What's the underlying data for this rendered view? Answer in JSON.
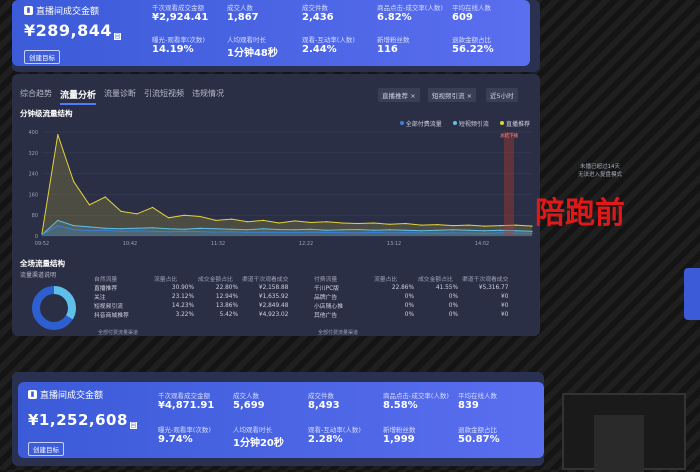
{
  "top_stats": {
    "title": "直播间成交金额",
    "amount": "¥289,844",
    "badge": "回",
    "button": "创建目标",
    "metrics": [
      {
        "label": "千次观看成交金额",
        "value": "¥2,924.41"
      },
      {
        "label": "成交人数",
        "value": "1,867"
      },
      {
        "label": "成交件数",
        "value": "2,436"
      },
      {
        "label": "商品点击-成交率(人数)",
        "value": "6.82%"
      },
      {
        "label": "平均在线人数",
        "value": "609"
      },
      {
        "label": "曝光-观看率(次数)",
        "value": "14.19%"
      },
      {
        "label": "人均观看时长",
        "value": "1分钟48秒"
      },
      {
        "label": "观看-互动率(人数)",
        "value": "2.44%"
      },
      {
        "label": "新增粉丝数",
        "value": "116"
      },
      {
        "label": "退款金额占比",
        "value": "56.22%"
      }
    ]
  },
  "tabs": [
    "综合趋势",
    "流量分析",
    "流量诊断",
    "引流短视频",
    "违规情况"
  ],
  "active_tab": "流量分析",
  "filters": {
    "f1": "直播推荐 ×",
    "f2": "短视频引流 ×",
    "f3": "近5小时"
  },
  "minute_chart_title": "分钟级流量结构",
  "chart_legend": [
    "全部付费流量",
    "短视频引流",
    "直播推荐"
  ],
  "chart_colors": {
    "total": "#e3d23a",
    "short_video": "#5ec0e8",
    "recommend": "#4e79f0",
    "paid": "#3c7fd8"
  },
  "chart_marker": "总结下播",
  "side_note_1": "未播已超过14天",
  "side_note_2": "无法进入复盘模式",
  "annotation": "陪跑前",
  "chart_data": {
    "type": "line",
    "x_ticks": [
      "09:52",
      "10:42",
      "11:32",
      "12:22",
      "13:12",
      "14:02"
    ],
    "y_ticks": [
      0,
      80,
      160,
      240,
      320,
      400
    ],
    "ylim": [
      0,
      400
    ],
    "series": [
      {
        "name": "直播推荐",
        "values": [
          10,
          390,
          210,
          120,
          150,
          95,
          85,
          110,
          70,
          80,
          75,
          60,
          65,
          55,
          60,
          50,
          58,
          52,
          55,
          50,
          48,
          50,
          45,
          48,
          42,
          44,
          40,
          42,
          38,
          40,
          42,
          38
        ]
      },
      {
        "name": "短视频引流",
        "values": [
          5,
          60,
          40,
          35,
          30,
          28,
          30,
          32,
          28,
          26,
          30,
          28,
          26,
          24,
          28,
          25,
          24,
          26,
          22,
          24,
          25,
          22,
          24,
          22,
          20,
          22,
          24,
          22,
          20,
          22,
          20,
          18
        ]
      },
      {
        "name": "全部付费流量",
        "values": [
          5,
          40,
          25,
          20,
          22,
          18,
          20,
          18,
          16,
          18,
          17,
          15,
          16,
          14,
          15,
          14,
          13,
          15,
          14,
          13,
          12,
          14,
          12,
          13,
          12,
          11,
          12,
          11,
          10,
          12,
          11,
          10
        ]
      }
    ]
  },
  "structure_title": "全场流量结构",
  "structure_sub": "流量渠道说明",
  "natural_header": [
    "自然流量",
    "流量占比",
    "成交金额占比",
    "渠道千次观看成交"
  ],
  "natural_rows": [
    [
      "直播推荐",
      "30.90%",
      "22.80%",
      "¥2,158.88"
    ],
    [
      "关注",
      "23.12%",
      "12.94%",
      "¥1,635.92"
    ],
    [
      "短视频引流",
      "14.23%",
      "13.86%",
      "¥2,849.48"
    ],
    [
      "抖音商城推荐",
      "3.22%",
      "5.42%",
      "¥4,923.02"
    ]
  ],
  "paid_header": [
    "付费流量",
    "流量占比",
    "成交金额占比",
    "渠道千次观看成交"
  ],
  "paid_rows": [
    [
      "千川PC版",
      "22.86%",
      "41.55%",
      "¥5,316.77"
    ],
    [
      "品牌广告",
      "0%",
      "0%",
      "¥0"
    ],
    [
      "小店随心推",
      "0%",
      "0%",
      "¥0"
    ],
    [
      "其他广告",
      "0%",
      "0%",
      "¥0"
    ]
  ],
  "natural_footer": "全部付费流量渠道",
  "paid_footer": "全部付费流量渠道",
  "bottom_stats": {
    "title": "直播间成交金额",
    "amount": "¥1,252,608",
    "badge": "回",
    "button": "创建目标",
    "metrics": [
      {
        "label": "千次观看成交金额",
        "value": "¥4,871.91"
      },
      {
        "label": "成交人数",
        "value": "5,699"
      },
      {
        "label": "成交件数",
        "value": "8,493"
      },
      {
        "label": "商品点击-成交率(人数)",
        "value": "8.58%"
      },
      {
        "label": "平均在线人数",
        "value": "839"
      },
      {
        "label": "曝光-观看率(次数)",
        "value": "9.74%"
      },
      {
        "label": "人均观看时长",
        "value": "1分钟20秒"
      },
      {
        "label": "观看-互动率(人数)",
        "value": "2.28%"
      },
      {
        "label": "新增粉丝数",
        "value": "1,999"
      },
      {
        "label": "退款金额占比",
        "value": "50.87%"
      }
    ]
  }
}
